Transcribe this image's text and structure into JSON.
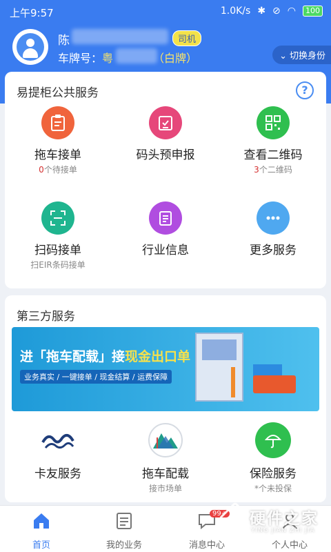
{
  "status_bar": {
    "time": "上午9:57",
    "speed": "1.0K/s",
    "battery": "100"
  },
  "profile": {
    "name": "陈",
    "role": "司机",
    "plate_label": "车牌号：",
    "plate_value": "粤",
    "plate_type": "（白牌）",
    "switch_label": "切换身份"
  },
  "public_services": {
    "title": "易提柜公共服务",
    "items": [
      {
        "label": "拖车接单",
        "sub_num": "0",
        "sub_text": "个待接单",
        "icon": "clipboard-icon",
        "color": "#f0643c"
      },
      {
        "label": "码头预申报",
        "sub_num": "",
        "sub_text": "",
        "icon": "checklist-icon",
        "color": "#e6477a"
      },
      {
        "label": "查看二维码",
        "sub_num": "3",
        "sub_text": "个二维码",
        "icon": "qrcode-icon",
        "color": "#2fbf4f"
      },
      {
        "label": "扫码接单",
        "sub_num": "",
        "sub_text": "扫EIR条码接单",
        "icon": "scan-icon",
        "color": "#1fb58f"
      },
      {
        "label": "行业信息",
        "sub_num": "",
        "sub_text": "",
        "icon": "document-icon",
        "color": "#b04de0"
      },
      {
        "label": "更多服务",
        "sub_num": "",
        "sub_text": "",
        "icon": "more-icon",
        "color": "#4fa8f0"
      }
    ]
  },
  "third_party": {
    "title": "第三方服务",
    "banner": {
      "prefix": "进「",
      "brand": "拖车配载",
      "mid": "」接",
      "highlight": "现金出口单",
      "tags": "业务真实 / 一键接单 / 现金结算 / 运费保障"
    },
    "items": [
      {
        "label": "卡友服务",
        "sub": "",
        "icon": "wave-logo-icon"
      },
      {
        "label": "拖车配载",
        "sub": "接市场单",
        "icon": "mountain-logo-icon"
      },
      {
        "label": "保险服务",
        "sub": "*个未投保",
        "icon": "umbrella-icon"
      }
    ]
  },
  "tabbar": {
    "items": [
      {
        "label": "首页",
        "active": true
      },
      {
        "label": "我的业务",
        "active": false
      },
      {
        "label": "消息中心",
        "active": false,
        "badge": "99+"
      },
      {
        "label": "个人中心",
        "active": false
      }
    ]
  },
  "watermark": {
    "text": "硬件之家",
    "sub": "YING JIAN ZHI JIA"
  },
  "colors": {
    "primary": "#3a7cf0",
    "badge": "#f3e24a",
    "alert": "#d43030"
  }
}
